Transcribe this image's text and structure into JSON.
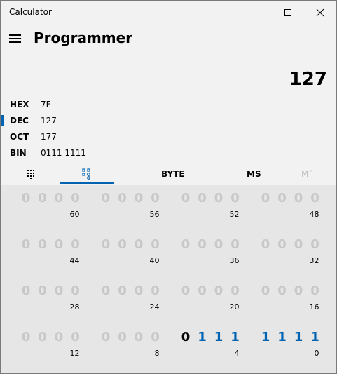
{
  "window": {
    "title": "Calculator",
    "controls": {
      "minimize": "minimize-icon",
      "maximize": "maximize-icon",
      "close": "close-icon"
    }
  },
  "header": {
    "menu_icon": "hamburger-menu-icon",
    "mode_title": "Programmer"
  },
  "display": {
    "value": "127"
  },
  "radix": [
    {
      "label": "HEX",
      "value": "7F",
      "selected": false
    },
    {
      "label": "DEC",
      "value": "127",
      "selected": true
    },
    {
      "label": "OCT",
      "value": "177",
      "selected": false
    },
    {
      "label": "BIN",
      "value": "0111 1111",
      "selected": false
    }
  ],
  "toolbar": {
    "full_keypad_icon": "keypad-grid-icon",
    "bit_toggle_icon": "bit-toggle-icon",
    "word_size": "BYTE",
    "memory_store": "MS",
    "memory_recall": "Mˇ"
  },
  "bit_rows": [
    {
      "bits": [
        "0",
        "0",
        "0",
        "0",
        "0",
        "0",
        "0",
        "0",
        "0",
        "0",
        "0",
        "0",
        "0",
        "0",
        "0",
        "0"
      ],
      "positions": [
        "60",
        "56",
        "52",
        "48"
      ]
    },
    {
      "bits": [
        "0",
        "0",
        "0",
        "0",
        "0",
        "0",
        "0",
        "0",
        "0",
        "0",
        "0",
        "0",
        "0",
        "0",
        "0",
        "0"
      ],
      "positions": [
        "44",
        "40",
        "36",
        "32"
      ]
    },
    {
      "bits": [
        "0",
        "0",
        "0",
        "0",
        "0",
        "0",
        "0",
        "0",
        "0",
        "0",
        "0",
        "0",
        "0",
        "0",
        "0",
        "0"
      ],
      "positions": [
        "28",
        "24",
        "20",
        "16"
      ]
    },
    {
      "bits": [
        "0",
        "0",
        "0",
        "0",
        "0",
        "0",
        "0",
        "0",
        "0",
        "1",
        "1",
        "1",
        "1",
        "1",
        "1",
        "1"
      ],
      "positions": [
        "12",
        "8",
        "4",
        "0"
      ]
    }
  ],
  "colors": {
    "accent": "#0063b1",
    "inactive_bit": "#c8c8c8",
    "background": "#f2f2f2"
  }
}
